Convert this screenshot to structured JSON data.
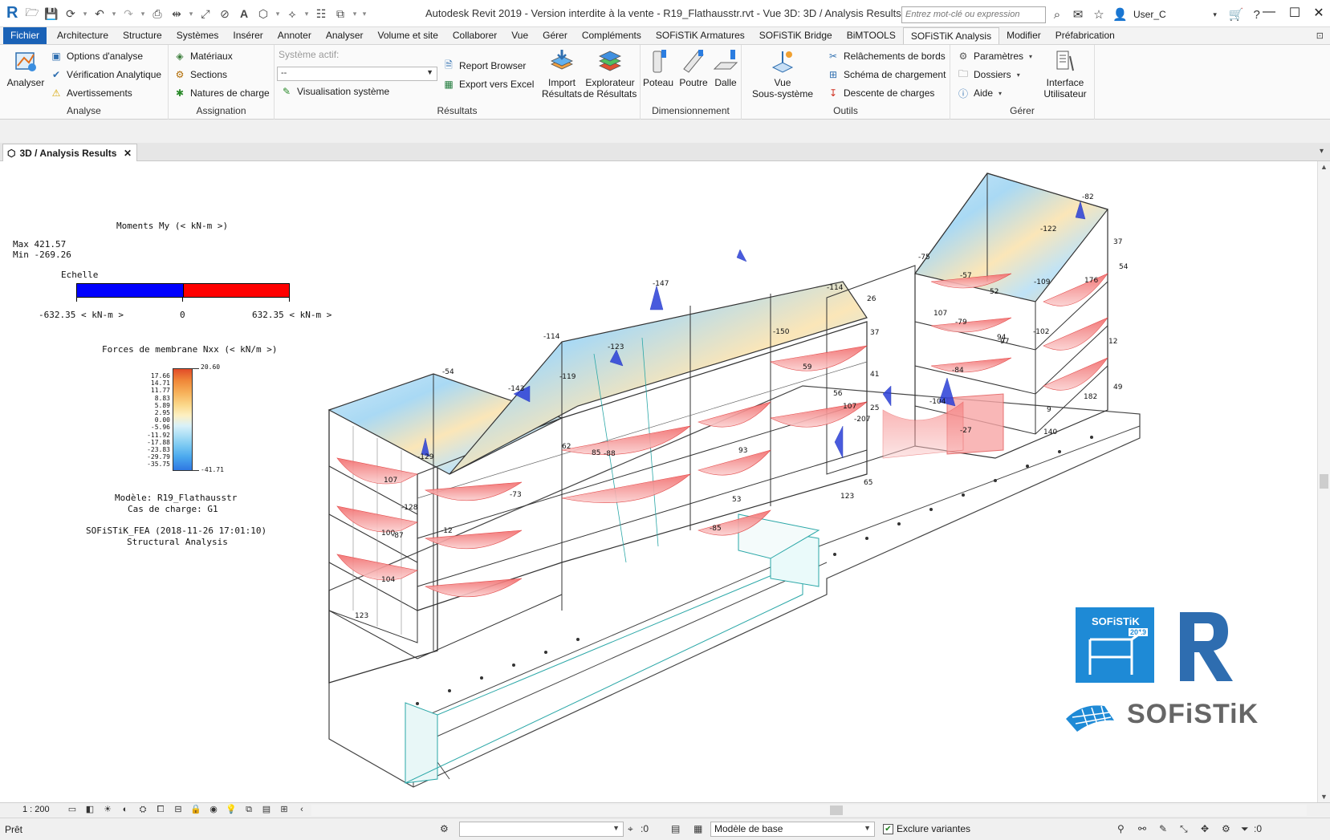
{
  "app": {
    "logo_letter": "R",
    "window_title": "Autodesk Revit 2019 - Version interdite à la vente - R19_Flathausstr.rvt - Vue 3D: 3D / Analysis Results",
    "search_placeholder": "Entrez mot-clé ou expression",
    "user_name": "User_C",
    "qat_icons": [
      "open-icon",
      "save-icon",
      "sync-icon",
      "undo-icon",
      "redo-icon",
      "print-icon",
      "measure-icon",
      "dimension-icon",
      "tag-icon",
      "text-icon",
      "3d-view-icon",
      "section-icon",
      "thin-lines-icon",
      "switch-windows-icon",
      "customize-icon"
    ]
  },
  "ribbon_tabs": [
    {
      "label": "Fichier",
      "state": "file"
    },
    {
      "label": "Architecture"
    },
    {
      "label": "Structure"
    },
    {
      "label": "Systèmes"
    },
    {
      "label": "Insérer"
    },
    {
      "label": "Annoter"
    },
    {
      "label": "Analyser"
    },
    {
      "label": "Volume et site"
    },
    {
      "label": "Collaborer"
    },
    {
      "label": "Vue"
    },
    {
      "label": "Gérer"
    },
    {
      "label": "Compléments"
    },
    {
      "label": "SOFiSTiK Armatures"
    },
    {
      "label": "SOFiSTiK Bridge"
    },
    {
      "label": "BiMTOOLS"
    },
    {
      "label": "SOFiSTiK Analysis",
      "state": "active"
    },
    {
      "label": "Modifier"
    },
    {
      "label": "Préfabrication"
    }
  ],
  "panels": {
    "analyse": {
      "title": "Analyse",
      "analyser": "Analyser",
      "options": "Options d'analyse",
      "verification": "Vérification Analytique",
      "warnings": "Avertissements"
    },
    "assignation": {
      "title": "Assignation",
      "materials": "Matériaux",
      "sections": "Sections",
      "load_natures": "Natures de charge"
    },
    "resultats": {
      "title": "Résultats",
      "active_system_label": "Système actif:",
      "active_system_value": "--",
      "system_visualization": "Visualisation système",
      "report_browser": "Report Browser",
      "export_excel": "Export vers Excel",
      "import_results": "Import\nRésultats",
      "results_explorer": "Explorateur\nde Résultats"
    },
    "dimensionnement": {
      "title": "Dimensionnement",
      "column": "Poteau",
      "beam": "Poutre",
      "slab": "Dalle"
    },
    "outils": {
      "title": "Outils",
      "subsystem_view": "Vue\nSous-système",
      "edge_releases": "Relâchements de bords",
      "loading_scheme": "Schéma de chargement",
      "load_descent": "Descente de charges"
    },
    "gerer": {
      "title": "Gérer",
      "parameters": "Paramètres",
      "folders": "Dossiers",
      "help": "Aide",
      "ui": "Interface\nUtilisateur"
    }
  },
  "view_tab": {
    "title": "3D / Analysis Results"
  },
  "legend": {
    "moments_title": "Moments My (< kN-m >)",
    "max": "Max 421.57",
    "min": "Min -269.26",
    "scale_label": "Echelle",
    "scale_min": "-632.35 < kN-m >",
    "scale_zero": "0",
    "scale_max": "632.35 < kN-m >",
    "scale_neg_color": "#0000ff",
    "scale_pos_color": "#ff0000",
    "membrane_title": "Forces de membrane Nxx (< kN/m >)",
    "colorbar_ticks": [
      "17.66",
      "14.71",
      "11.77",
      "8.83",
      "5.89",
      "2.95",
      "0.00",
      "-5.96",
      "-11.92",
      "-17.88",
      "-23.83",
      "-29.79",
      "-35.75"
    ],
    "colorbar_top": "20.60",
    "colorbar_bottom": "-41.71",
    "model": "Modèle: R19_Flathausstr",
    "load_case": "Cas de charge: G1",
    "software": "SOFiSTiK_FEA (2018-11-26 17:01:10)",
    "analysis": "Structural Analysis"
  },
  "model_labels": [
    "-82",
    "-122",
    "-75",
    "-57",
    "-114",
    "-147",
    "-150",
    "-123",
    "-114",
    "-119",
    "-54",
    "-143",
    "-129",
    "-128",
    "-87",
    "-12",
    "-73",
    "-88",
    "-85",
    "-207",
    "-104",
    "-109",
    "-102",
    "-79",
    "-84",
    "-27",
    "176",
    "182",
    "140",
    "107",
    "104",
    "100",
    "123",
    "93",
    "53",
    "52",
    "94",
    "62",
    "37",
    "12",
    "49",
    "54",
    "59",
    "56",
    "107",
    "123",
    "107",
    "9",
    "85",
    "65",
    "41",
    "97",
    "37",
    "26",
    "25"
  ],
  "branding": {
    "sofistik_badge": "SOFiSTiK",
    "sofistik_year": "2019",
    "revit_letter": "R",
    "sofistik_wordmark": "SOFiSTiK"
  },
  "view_control": {
    "scale": "1 : 200"
  },
  "status": {
    "text": "Prêt",
    "selection_count": ":0",
    "model_select": "Modèle de base",
    "exclude_variants": "Exclure variantes",
    "filter_count": ":0"
  }
}
